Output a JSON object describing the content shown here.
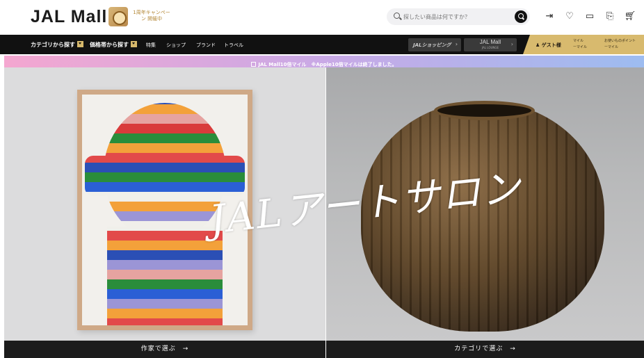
{
  "header": {
    "logo": "JAL Mall",
    "campaign": "1周年キャンペーン 開催中",
    "search_placeholder": "探したい商品は何ですか？",
    "icons": [
      "login-icon",
      "heart-icon",
      "card-icon",
      "history-icon",
      "cart-icon"
    ]
  },
  "nav": {
    "category": "カテゴリから探す",
    "price": "価格帯から探す",
    "special": "特集",
    "shop": "ショップ",
    "brand": "ブランド",
    "travel": "トラベル",
    "jal_shopping": "JALショッピング",
    "lounge": "JAL Mall",
    "lounge_sub": "JAL LOUNGE",
    "guest": "ゲスト様",
    "miles_label": "マイル",
    "miles_value": "ーマイル",
    "points_label": "お使いものポイント",
    "points_value": "ーマイル"
  },
  "promo": {
    "text": "JAL Mall10倍マイル　※Apple10倍マイルは終了しました。"
  },
  "hero": {
    "title": "JALアートサロン",
    "choose_artist": "作家で選ぶ",
    "choose_category": "カテゴリで選ぶ",
    "arrow": "→"
  },
  "colors": {
    "nav_bg": "#111111",
    "gold": "#d8ba6e",
    "promo_start": "#f4a7d0",
    "promo_end": "#9dbcf0"
  }
}
